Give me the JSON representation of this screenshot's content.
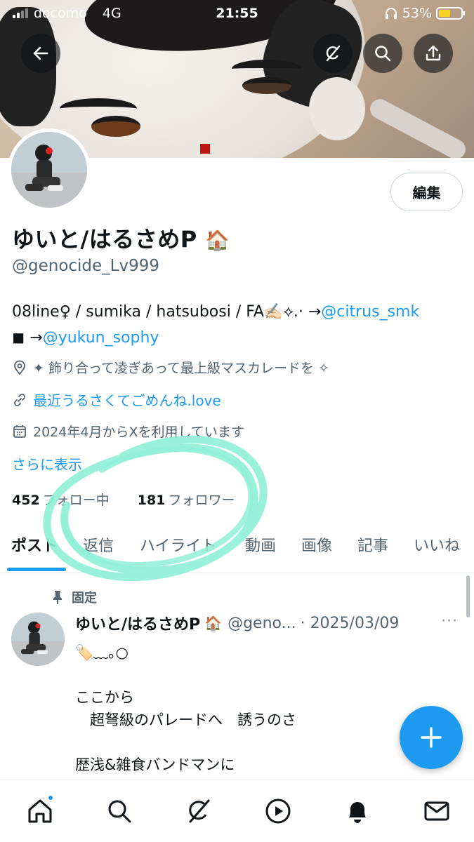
{
  "status_bar": {
    "carrier": "docomo",
    "network": "4G",
    "time": "21:55",
    "battery": "53%",
    "battery_level": 0.53,
    "icons": [
      "signal-icon",
      "headphones-icon",
      "battery-icon"
    ]
  },
  "header": {
    "buttons": [
      "back-arrow-icon",
      "grok-icon",
      "search-icon",
      "share-icon"
    ]
  },
  "profile": {
    "edit_label": "編集",
    "display_name": "ゆいと/はるさめP",
    "name_emoji": "🏠",
    "handle": "@genocide_Lv999",
    "bio_line1_text": "08line♀ / sumika / hatsubosi / FA✍🏻⟡.· →",
    "bio_line1_link": "@citrus_smk",
    "bio_line2_text": "◼︎ →",
    "bio_line2_link": "@yukun_sophy",
    "location": "✦ 飾り合って凌ぎあって最上級マスカレードを ✧",
    "website": "最近うるさくてごめんね.love",
    "joined": "2024年4月からXを利用しています",
    "show_more": "さらに表示",
    "following_count": "452",
    "following_label": "フォロー中",
    "followers_count": "181",
    "followers_label": "フォロワー"
  },
  "tabs": [
    {
      "label": "ポスト",
      "active": true
    },
    {
      "label": "返信",
      "active": false
    },
    {
      "label": "ハイライト",
      "active": false
    },
    {
      "label": "動画",
      "active": false
    },
    {
      "label": "画像",
      "active": false
    },
    {
      "label": "記事",
      "active": false
    },
    {
      "label": "いいね",
      "active": false
    }
  ],
  "pinned_post": {
    "pinned_label": "固定",
    "author_name": "ゆいと/はるさめP",
    "author_emoji": "🏠",
    "author_handle": "@geno...",
    "date": "· 2025/03/09",
    "more": "···",
    "lines": [
      "🏷️﹏｡○",
      "",
      "ここから",
      "　超弩級のパレードへ　誘うのさ",
      "",
      "歴浅&雑食バンドマンに"
    ]
  },
  "bottom_nav": [
    "home-icon",
    "search-icon",
    "grok-icon",
    "video-icon",
    "notifications-icon",
    "messages-icon"
  ],
  "colors": {
    "accent": "#1d9bf0",
    "text_primary": "#0f1419",
    "text_secondary": "#536471",
    "scribble": "#8ff0d6"
  }
}
